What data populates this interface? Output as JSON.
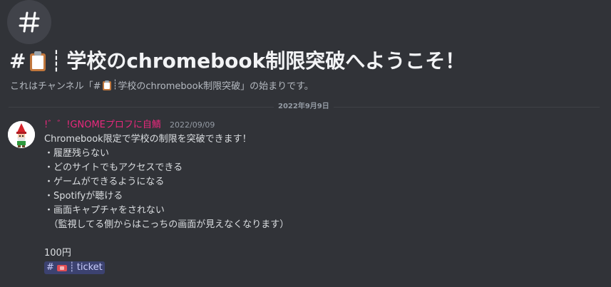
{
  "welcome": {
    "title_hash": "#",
    "title_divider": "┊",
    "title_text": "学校のchromebook制限突破へようこそ！",
    "subtitle_prefix": "これはチャンネル「#",
    "subtitle_divider": "┊",
    "subtitle_channel": "学校のchromebook制限突破",
    "subtitle_suffix": "」の始まりです。"
  },
  "date_divider": "2022年9月9日",
  "message": {
    "username": "!゛゛!GNOMEプロフに自鯖",
    "timestamp": "2022/09/09",
    "lines": [
      "Chromebook限定で学校の制限を突破できます！",
      "・履歴残らない",
      "・どのサイトでもアクセスできる",
      "・ゲームができるようになる",
      "・Spotifyが聴ける",
      "・画面キャプチャをされない",
      "　（監視してる側からはこっちの画面が見えなくなります）",
      "",
      "100円"
    ],
    "mention": {
      "hash": "#",
      "divider": "┊",
      "name": "ticket"
    }
  },
  "colors": {
    "background": "#313338",
    "username": "#e9287d",
    "mention_bg": "#3c4270",
    "mention_text": "#c9cdfb"
  },
  "icons": {
    "channel": "hash-icon",
    "title_emoji": "clipboard-icon",
    "mention_emoji": "ticket-icon",
    "avatar": "gnome-avatar"
  }
}
